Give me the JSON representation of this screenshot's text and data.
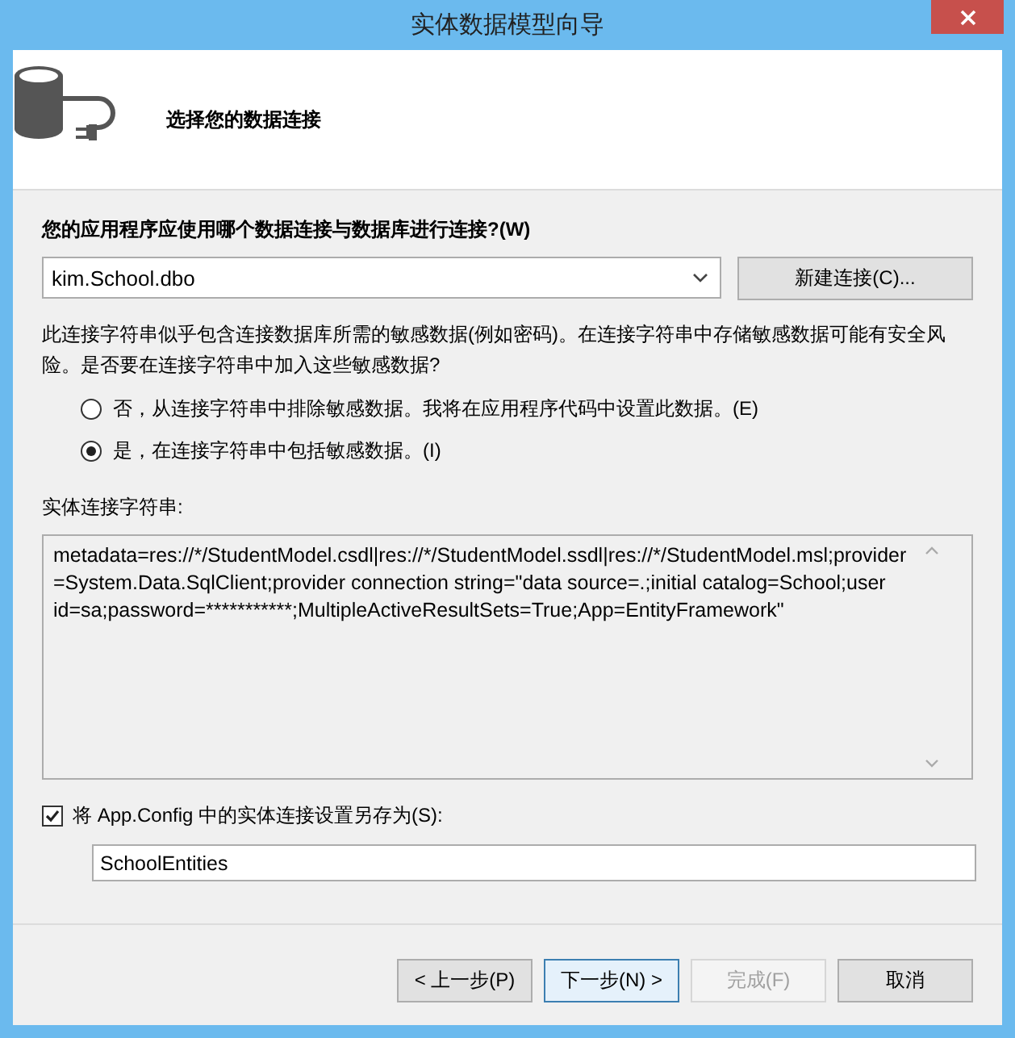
{
  "window": {
    "title": "实体数据模型向导"
  },
  "header": {
    "title": "选择您的数据连接"
  },
  "connection": {
    "label": "您的应用程序应使用哪个数据连接与数据库进行连接?(W)",
    "value": "kim.School.dbo",
    "new_button": "新建连接(C)..."
  },
  "sensitive_notice": "此连接字符串似乎包含连接数据库所需的敏感数据(例如密码)。在连接字符串中存储敏感数据可能有安全风险。是否要在连接字符串中加入这些敏感数据?",
  "sensitive_options": [
    {
      "label": "否，从连接字符串中排除敏感数据。我将在应用程序代码中设置此数据。(E)",
      "selected": false
    },
    {
      "label": "是，在连接字符串中包括敏感数据。(I)",
      "selected": true
    }
  ],
  "entity_connection": {
    "label": "实体连接字符串:",
    "value": "metadata=res://*/StudentModel.csdl|res://*/StudentModel.ssdl|res://*/StudentModel.msl;provider=System.Data.SqlClient;provider connection string=\"data source=.;initial catalog=School;user id=sa;password=***********;MultipleActiveResultSets=True;App=EntityFramework\""
  },
  "save_setting": {
    "label": "将 App.Config 中的实体连接设置另存为(S):",
    "checked": true,
    "value": "SchoolEntities"
  },
  "buttons": [
    {
      "label": "< 上一步(P)",
      "disabled": false,
      "default": false
    },
    {
      "label": "下一步(N) >",
      "disabled": false,
      "default": true
    },
    {
      "label": "完成(F)",
      "disabled": true,
      "default": false
    },
    {
      "label": "取消",
      "disabled": false,
      "default": false
    }
  ]
}
